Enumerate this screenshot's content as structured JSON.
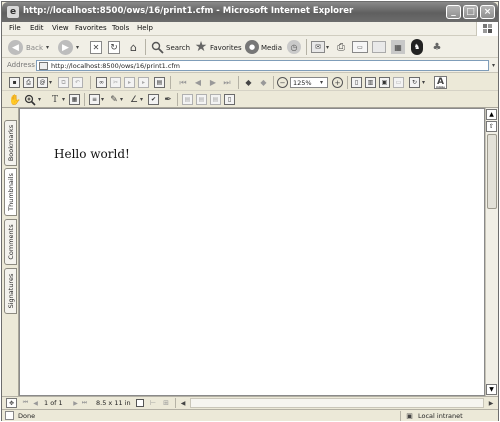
{
  "window": {
    "title": "http://localhost:8500/ows/16/print1.cfm - Microsoft Internet Explorer",
    "minimize": "_",
    "maximize": "□",
    "close": "×"
  },
  "menu": [
    "File",
    "Edit",
    "View",
    "Favorites",
    "Tools",
    "Help"
  ],
  "toolbar": {
    "back": "Back",
    "search": "Search",
    "favorites": "Favorites",
    "media": "Media"
  },
  "address": {
    "label": "Address",
    "value": "http://localhost:8500/ows/16/print1.cfm"
  },
  "acrobat": {
    "zoom": "125%",
    "adobe": "Adobe"
  },
  "nav_tabs": [
    "Bookmarks",
    "Thumbnails",
    "Comments",
    "Signatures"
  ],
  "document": {
    "text": "Hello world!"
  },
  "page_nav": {
    "page": "1 of 1",
    "size": "8.5 x 11 in"
  },
  "status": {
    "left": "Done",
    "zone": "Local intranet"
  }
}
